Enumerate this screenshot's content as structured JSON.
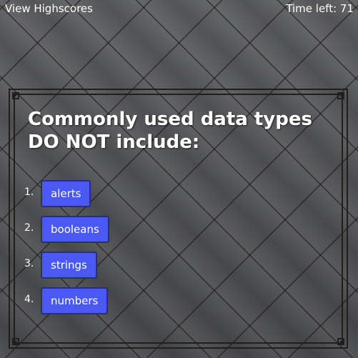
{
  "topbar": {
    "highscores_link": "View Highscores",
    "timer_label": "Time left: 71"
  },
  "quiz": {
    "question": "Commonly used data types DO NOT include:",
    "answers": [
      {
        "number": "1.",
        "label": "alerts"
      },
      {
        "number": "2.",
        "label": "booleans"
      },
      {
        "number": "3.",
        "label": "strings"
      },
      {
        "number": "4.",
        "label": "numbers"
      }
    ]
  },
  "colors": {
    "button_bg": "#4a59f4",
    "button_border": "#2a2f73",
    "frame_border": "#1f1f20",
    "text": "#ffffff"
  }
}
